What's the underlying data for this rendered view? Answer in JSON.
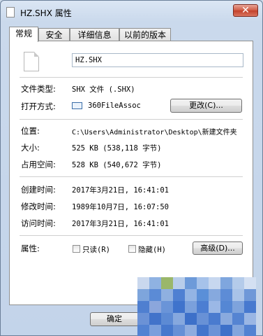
{
  "window": {
    "title": "HZ.SHX 属性",
    "close_label": "✕"
  },
  "tabs": [
    {
      "label": "常规",
      "active": true
    },
    {
      "label": "安全",
      "active": false
    },
    {
      "label": "详细信息",
      "active": false
    },
    {
      "label": "以前的版本",
      "active": false
    }
  ],
  "general": {
    "filename": "HZ.SHX",
    "file_type_label": "文件类型:",
    "file_type_value": "SHX 文件 (.SHX)",
    "opens_with_label": "打开方式:",
    "opens_with_value": "360FileAssoc",
    "change_button": "更改(C)...",
    "location_label": "位置:",
    "location_value": "C:\\Users\\Administrator\\Desktop\\新建文件夹",
    "size_label": "大小:",
    "size_value": "525 KB (538,118 字节)",
    "size_on_disk_label": "占用空间:",
    "size_on_disk_value": "528 KB (540,672 字节)",
    "created_label": "创建时间:",
    "created_value": "2017年3月21日, 16:41:01",
    "modified_label": "修改时间:",
    "modified_value": "1989年10月7日, 16:07:50",
    "accessed_label": "访问时间:",
    "accessed_value": "2017年3月21日, 16:41:01",
    "attributes_label": "属性:",
    "readonly_label": "只读(R)",
    "hidden_label": "隐藏(H)",
    "advanced_button": "高级(D)..."
  },
  "footer": {
    "ok_button": "确定"
  },
  "colors": {
    "window_frame": "#c3d4ea",
    "close_button": "#c2402a",
    "mosaic_blue": "#5a8fd8"
  }
}
